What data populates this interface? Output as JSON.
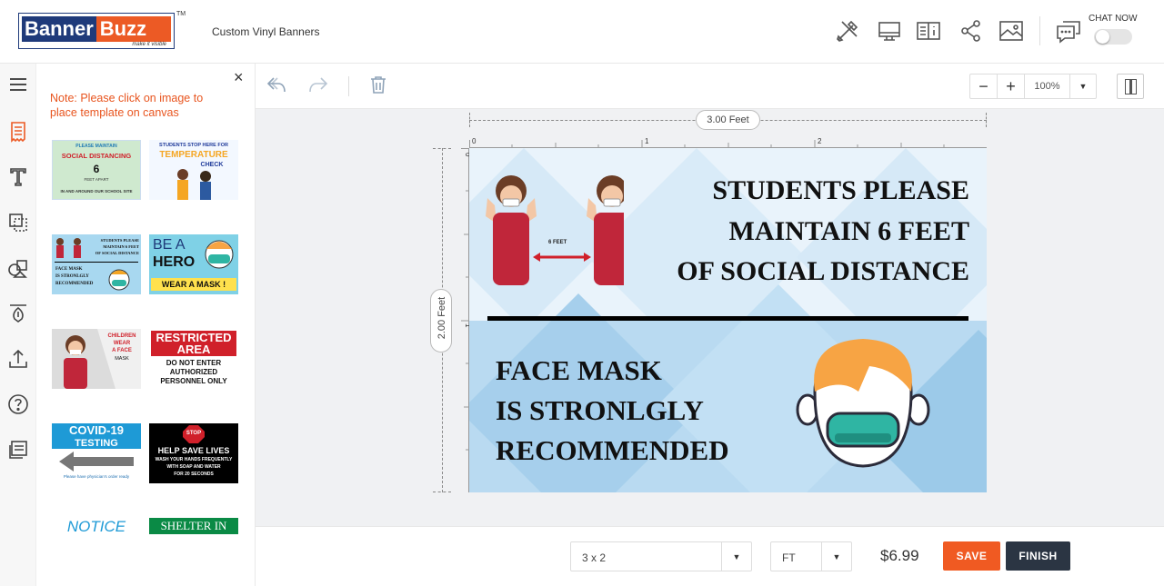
{
  "header": {
    "logo_text_a": "Banner",
    "logo_text_b": "Buzz",
    "logo_tagline": "make it visible",
    "trademark": "TM",
    "product_title": "Custom Vinyl Banners",
    "icons": [
      "tools-icon",
      "monitor-icon",
      "book-info-icon",
      "share-icon",
      "image-icon",
      "chat-icon"
    ],
    "chat_label": "CHAT NOW",
    "chat_toggle_on": false
  },
  "rail": {
    "items": [
      "menu-icon",
      "templates-icon",
      "text-icon",
      "layers-icon",
      "shapes-icon",
      "clipart-icon",
      "upload-icon",
      "help-icon",
      "notes-icon"
    ],
    "active": "templates-icon"
  },
  "panel": {
    "close": "×",
    "note": "Note: Please click on image to place template on canvas",
    "templates": {
      "t1": {
        "line1": "PLEASE MAINTAIN",
        "line2": "SOCIAL DISTANCING",
        "line3": "6",
        "line4": "FEET APART",
        "line5": "IN AND AROUND OUR SCHOOL SITE"
      },
      "t2": {
        "line1": "STUDENTS STOP HERE FOR",
        "line2": "TEMPERATURE",
        "line3": "CHECK"
      },
      "t3": {
        "line1": "STUDENTS PLEASE",
        "line2": "MAINTAIN 6 FEET",
        "line3": "OF SOCIAL DISTANCE",
        "line4": "FACE MASK",
        "line5": "IS STRONLGLY",
        "line6": "RECOMMENDED"
      },
      "t4": {
        "line1": "BE A",
        "line2": "HERO",
        "line3": "WEAR A MASK !"
      },
      "t5": {
        "line1": "CHILDREN",
        "line2": "WEAR",
        "line3": "A FACE",
        "line4": "MASK"
      },
      "t6": {
        "line1": "RESTRICTED",
        "line2": "AREA",
        "line3": "DO NOT ENTER",
        "line4": "AUTHORIZED",
        "line5": "PERSONNEL ONLY"
      },
      "t7": {
        "line1": "COVID-19",
        "line2": "TESTING",
        "line3": "Please have physician's order ready"
      },
      "t8": {
        "line1": "STOP",
        "line2": "HELP SAVE LIVES",
        "line3": "WASH YOUR HANDS FREQUENTLY",
        "line4": "WITH SOAP AND WATER",
        "line5": "FOR 20 SECONDS"
      },
      "t9": {
        "line1": "NOTICE"
      },
      "t10": {
        "line1": "SHELTER IN"
      }
    }
  },
  "toolbar": {
    "undo": "undo-icon",
    "redo": "redo-icon",
    "delete": "trash-icon",
    "zoom_out": "−",
    "zoom_in": "+",
    "zoom_value": "100%",
    "zoom_dropdown": "▼"
  },
  "canvas": {
    "width_label": "3.00 Feet",
    "height_label": "2.00 Feet",
    "ruler_h": [
      "0",
      "1",
      "2"
    ],
    "ruler_v": [
      "0",
      "1"
    ],
    "banner": {
      "line1": "STUDENTS PLEASE",
      "line2": "MAINTAIN 6 FEET",
      "line3": "OF SOCIAL DISTANCE",
      "distance_label": "6 FEET",
      "line4": "FACE MASK",
      "line5": "IS STRONLGLY",
      "line6": "RECOMMENDED"
    }
  },
  "bottom": {
    "size_value": "3 x 2",
    "unit_value": "FT",
    "arrow": "▼",
    "price": "$6.99",
    "save_label": "SAVE",
    "finish_label": "FINISH"
  },
  "colors": {
    "brand_blue": "#1f3a7a",
    "brand_orange": "#ec5a25",
    "finish_dark": "#2b3543"
  }
}
